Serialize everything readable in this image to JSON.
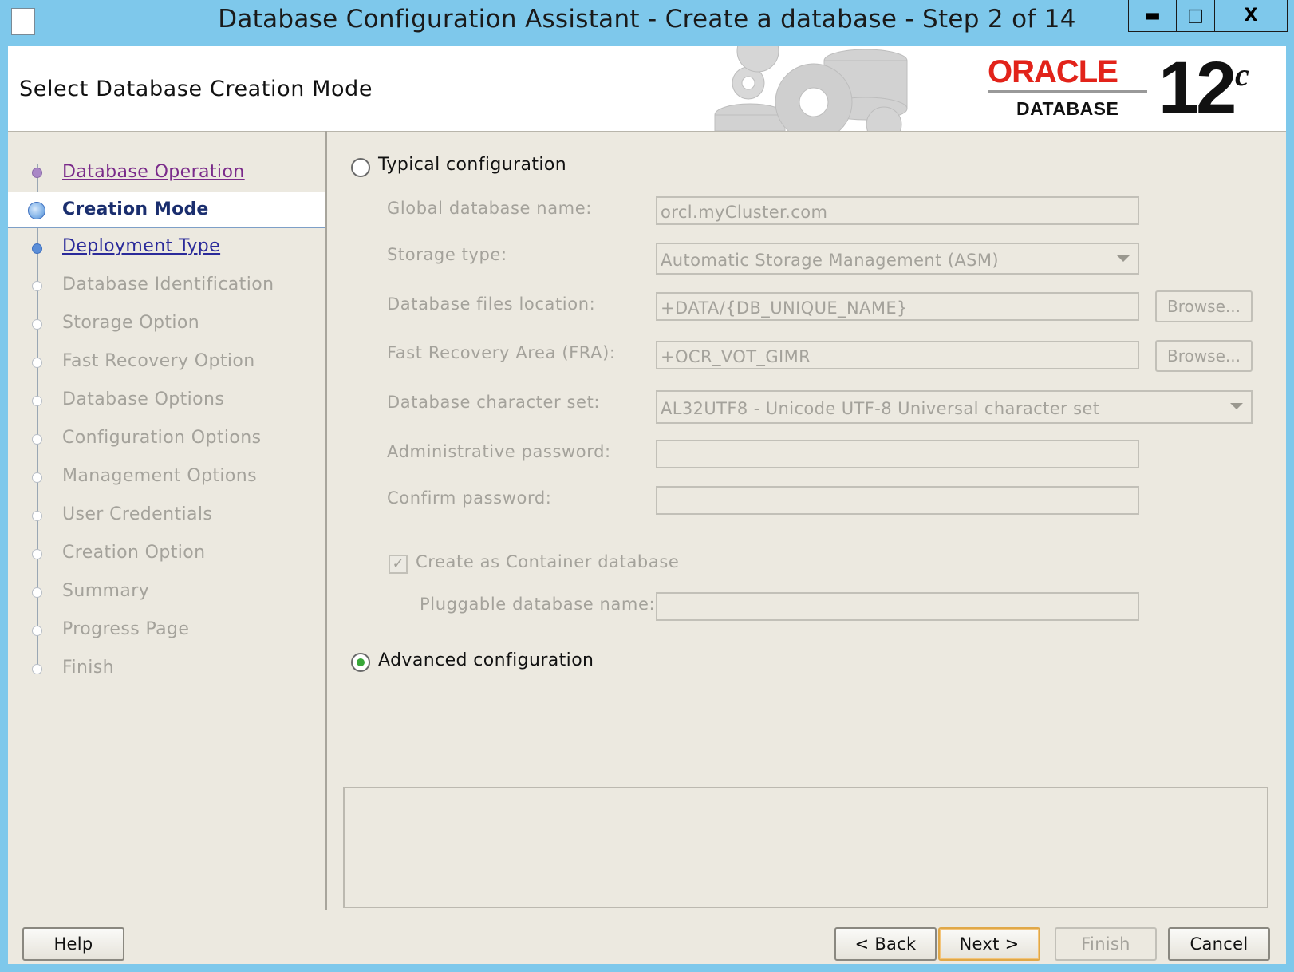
{
  "window": {
    "title": "Database Configuration Assistant - Create a database - Step 2 of 14",
    "min_glyph": "▬",
    "max_glyph": "□",
    "close_glyph": "X"
  },
  "header": {
    "page_title": "Select Database Creation Mode",
    "brand": "ORACLE",
    "product": "DATABASE",
    "version": "12",
    "version_suffix": "c",
    "brand_color": "#e2231a"
  },
  "nav": {
    "items": [
      {
        "label": "Database Operation",
        "state": "visited"
      },
      {
        "label": "Creation Mode",
        "state": "current"
      },
      {
        "label": "Deployment Type",
        "state": "link"
      },
      {
        "label": "Database Identification",
        "state": "disabled"
      },
      {
        "label": "Storage Option",
        "state": "disabled"
      },
      {
        "label": "Fast Recovery Option",
        "state": "disabled"
      },
      {
        "label": "Database Options",
        "state": "disabled"
      },
      {
        "label": "Configuration Options",
        "state": "disabled"
      },
      {
        "label": "Management Options",
        "state": "disabled"
      },
      {
        "label": "User Credentials",
        "state": "disabled"
      },
      {
        "label": "Creation Option",
        "state": "disabled"
      },
      {
        "label": "Summary",
        "state": "disabled"
      },
      {
        "label": "Progress Page",
        "state": "disabled"
      },
      {
        "label": "Finish",
        "state": "disabled"
      }
    ]
  },
  "form": {
    "typical_label": "Typical configuration",
    "typical_selected": false,
    "global_db_name_label": "Global database name:",
    "global_db_name_value": "orcl.myCluster.com",
    "storage_type_label": "Storage type:",
    "storage_type_value": "Automatic Storage Management (ASM)",
    "db_files_location_label": "Database files location:",
    "db_files_location_value": "+DATA/{DB_UNIQUE_NAME}",
    "fra_label": "Fast Recovery Area (FRA):",
    "fra_value": "+OCR_VOT_GIMR",
    "browse_label": "Browse...",
    "charset_label": "Database character set:",
    "charset_value": "AL32UTF8 - Unicode UTF-8 Universal character set",
    "admin_password_label": "Administrative password:",
    "admin_password_value": "",
    "confirm_password_label": "Confirm password:",
    "confirm_password_value": "",
    "container_db_label": "Create as Container database",
    "container_db_checked": true,
    "pluggable_db_name_label": "Pluggable database name:",
    "pluggable_db_name_value": "",
    "advanced_label": "Advanced configuration",
    "advanced_selected": true
  },
  "buttons": {
    "help": "Help",
    "back": "< Back",
    "next": "Next >",
    "finish": "Finish",
    "cancel": "Cancel"
  }
}
